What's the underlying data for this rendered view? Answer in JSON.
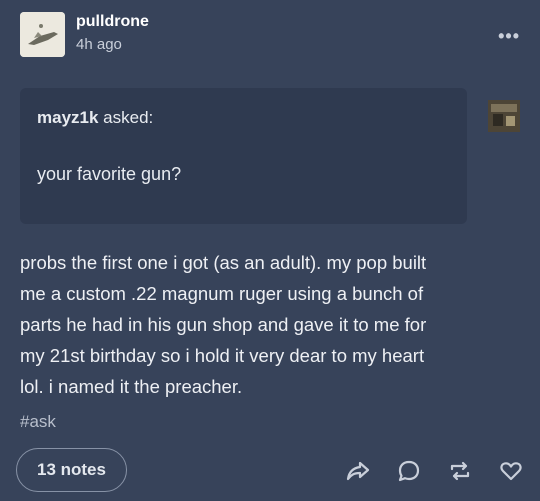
{
  "post": {
    "blog_name": "pulldrone",
    "timestamp": "4h ago",
    "more_icon": "meatball-menu-icon"
  },
  "ask": {
    "asker": "mayz1k",
    "asked_word": "asked:",
    "question": "your favorite gun?"
  },
  "answer": {
    "lines": [
      "probs the first one i got (as an adult). my pop built",
      "me a custom .22 magnum ruger using a bunch of",
      "parts he had in his gun shop and gave it to me for",
      "my 21st birthday so i hold it very dear to my heart",
      "lol. i named it the preacher."
    ]
  },
  "tags": [
    "#ask"
  ],
  "footer": {
    "notes_label": "13 notes",
    "icons": [
      "share-icon",
      "reply-icon",
      "reblog-icon",
      "like-icon"
    ]
  },
  "colors": {
    "background": "#37435a",
    "ask_box": "#2f3a50"
  }
}
